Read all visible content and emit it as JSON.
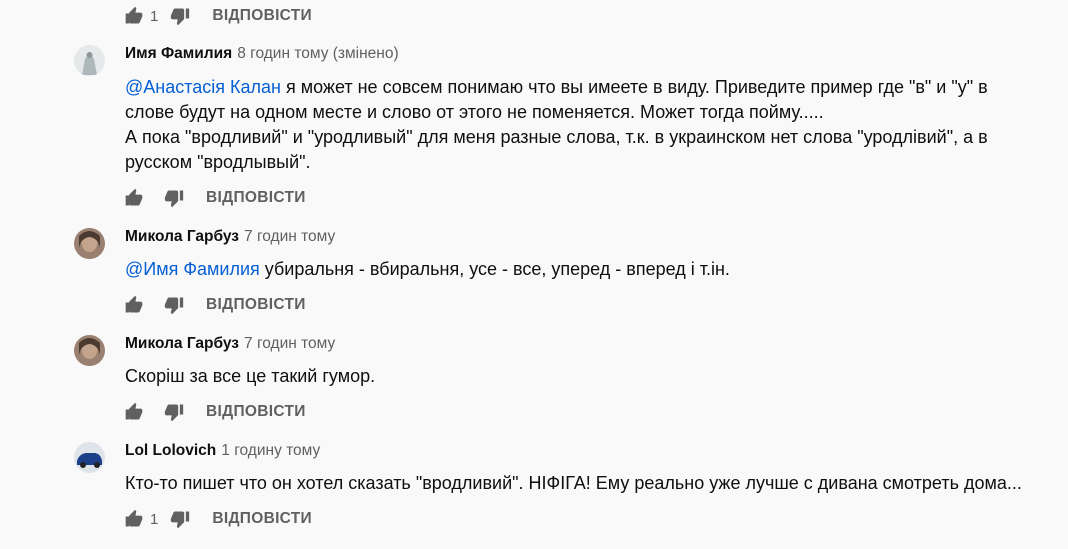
{
  "labels": {
    "reply": "ВІДПОВІСТИ"
  },
  "top_actions": {
    "likes": "1"
  },
  "comments": [
    {
      "author": "Имя Фамилия",
      "time": "8 годин тому (змінено)",
      "mention": "@Анастасія Калан",
      "line1_rest": " я может не совсем понимаю что вы имеете в виду. Приведите пример где \"в\" и \"у\" в",
      "line2": "слове будут на одном месте и слово от этого не поменяется. Может тогда пойму.....",
      "line3": "А пока \"вродливий\" и \"уродливый\" для меня разные слова, т.к. в украинском нет слова \"уродлівий\", а в",
      "line4": "русском \"вродлывый\".",
      "avatar_color": "#c9cfd0"
    },
    {
      "author": "Микола Гарбуз",
      "time": "7 годин тому",
      "mention": "@Имя Фамилия",
      "text_rest": " убиральня - вбиральня, усе - все, уперед - вперед і т.ін.",
      "avatar_color": "#8a6e5a"
    },
    {
      "author": "Микола Гарбуз",
      "time": "7 годин тому",
      "text": "Скоріш за все це такий гумор.",
      "avatar_color": "#8a6e5a"
    },
    {
      "author": "Lol Lolovich",
      "time": "1 годину тому",
      "text": "Кто-то пишет что он хотел сказать \"вродливий\". НІФІГА! Ему реально уже лучше с дивана смотреть дома...",
      "likes": "1",
      "avatar_color": "#1c3f8a"
    }
  ]
}
